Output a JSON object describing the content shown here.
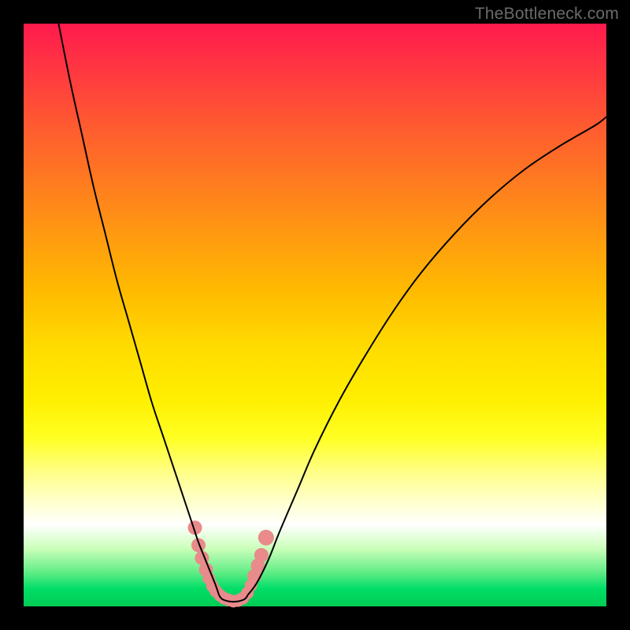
{
  "watermark": "TheBottleneck.com",
  "chart_data": {
    "type": "line",
    "title": "",
    "xlabel": "",
    "ylabel": "",
    "xlim": [
      0,
      100
    ],
    "ylim": [
      0,
      100
    ],
    "series": [
      {
        "name": "left-curve",
        "x": [
          6,
          8,
          10,
          12,
          14,
          16,
          18,
          20,
          22,
          24,
          26,
          27,
          28,
          29,
          30,
          31,
          32,
          33,
          33.5
        ],
        "values": [
          100,
          90,
          81,
          72,
          64,
          56,
          49,
          42,
          35,
          29,
          23,
          20,
          17,
          14,
          11,
          8.5,
          6,
          3.5,
          2
        ]
      },
      {
        "name": "right-curve",
        "x": [
          38.5,
          40,
          42,
          44,
          47,
          50,
          54,
          58,
          63,
          68,
          74,
          80,
          86,
          92,
          98,
          100
        ],
        "values": [
          2,
          4,
          8,
          13,
          20,
          27,
          35,
          42,
          50,
          57,
          64,
          70,
          75,
          79,
          82.5,
          84
        ]
      },
      {
        "name": "bottom-flat",
        "x": [
          33.5,
          34,
          35,
          36,
          37,
          38,
          38.5
        ],
        "values": [
          2,
          1.3,
          0.9,
          0.8,
          0.9,
          1.3,
          2
        ]
      }
    ],
    "markers": {
      "name": "highlight-dots",
      "color": "#e98a8b",
      "points": [
        {
          "x": 29.4,
          "y": 13.5,
          "r": 9
        },
        {
          "x": 30.0,
          "y": 10.5,
          "r": 9
        },
        {
          "x": 30.6,
          "y": 8.3,
          "r": 9
        },
        {
          "x": 31.3,
          "y": 6.3,
          "r": 9
        },
        {
          "x": 31.8,
          "y": 4.8,
          "r": 8
        },
        {
          "x": 32.4,
          "y": 3.5,
          "r": 8
        },
        {
          "x": 33.0,
          "y": 2.6,
          "r": 8
        },
        {
          "x": 33.7,
          "y": 1.9,
          "r": 8
        },
        {
          "x": 34.4,
          "y": 1.4,
          "r": 8
        },
        {
          "x": 35.2,
          "y": 1.1,
          "r": 8
        },
        {
          "x": 36.0,
          "y": 0.9,
          "r": 8
        },
        {
          "x": 36.8,
          "y": 1.0,
          "r": 8
        },
        {
          "x": 37.6,
          "y": 1.4,
          "r": 8
        },
        {
          "x": 38.4,
          "y": 2.3,
          "r": 8
        },
        {
          "x": 39.0,
          "y": 3.6,
          "r": 8
        },
        {
          "x": 39.6,
          "y": 5.2,
          "r": 9
        },
        {
          "x": 40.2,
          "y": 7.0,
          "r": 9
        },
        {
          "x": 40.8,
          "y": 8.8,
          "r": 9
        },
        {
          "x": 41.6,
          "y": 11.8,
          "r": 10
        }
      ]
    },
    "background_gradient": {
      "top_color": "#ff1a4d",
      "bottom_color": "#00cc55"
    }
  }
}
